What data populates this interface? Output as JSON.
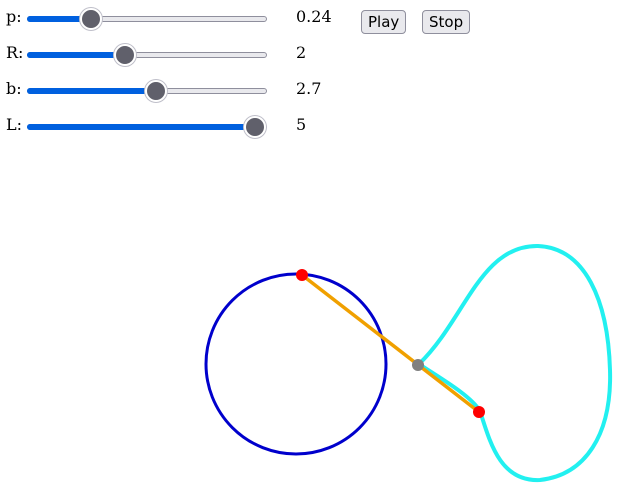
{
  "controls": {
    "sliders": [
      {
        "label": "p:",
        "value": 0.24,
        "value_text": "0.24",
        "min": 0,
        "max": 1
      },
      {
        "label": "R:",
        "value": 2,
        "value_text": "2",
        "min": 0,
        "max": 5
      },
      {
        "label": "b:",
        "value": 2.7,
        "value_text": "2.7",
        "min": 0,
        "max": 5
      },
      {
        "label": "L:",
        "value": 5,
        "value_text": "5",
        "min": 0,
        "max": 5
      }
    ],
    "play_label": "Play",
    "stop_label": "Stop"
  },
  "colors": {
    "circle": "#0000cc",
    "rod": "#f0a000",
    "curve": "#22f0f0",
    "endpoint": "#ff0000",
    "pivot": "#808080",
    "slider_fill": "#0060df"
  }
}
